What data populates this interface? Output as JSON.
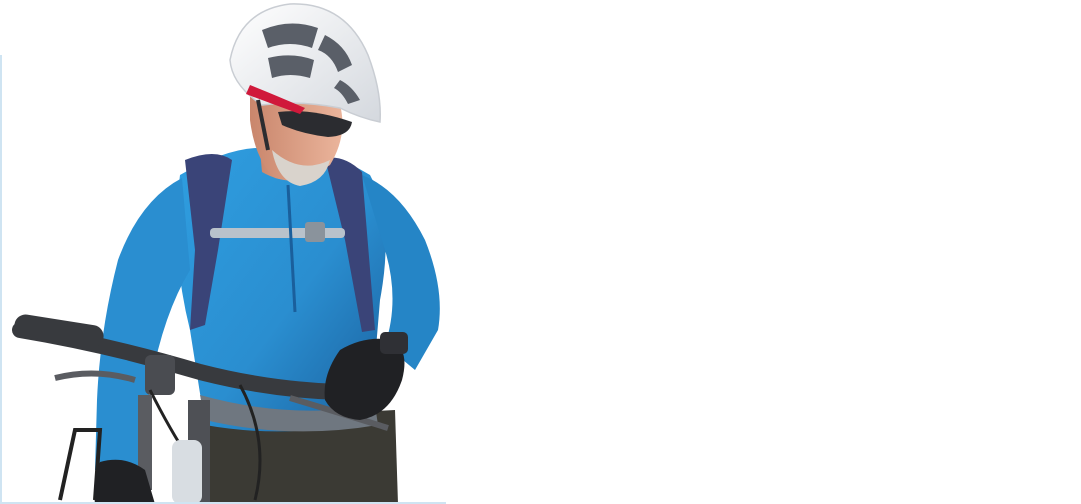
{
  "photo": {
    "subject": "cyclist-with-mountain-bike",
    "background": "#ffffff",
    "colors": {
      "jersey": "#2a8ed0",
      "jersey_shadow": "#1a5f9c",
      "pack": "#3a4478",
      "pack_strap": "#b9c2cb",
      "helmet": "#eef0f3",
      "helmet_vents": "#5a5f68",
      "helmet_accent": "#d0193b",
      "skin": "#e0a48a",
      "beard": "#d9d3cc",
      "lenses": "#2b2c30",
      "gloves": "#202124",
      "grip": "#383a3e",
      "bike_metal": "#5a5c61",
      "shorts": "#3b3a34"
    }
  }
}
